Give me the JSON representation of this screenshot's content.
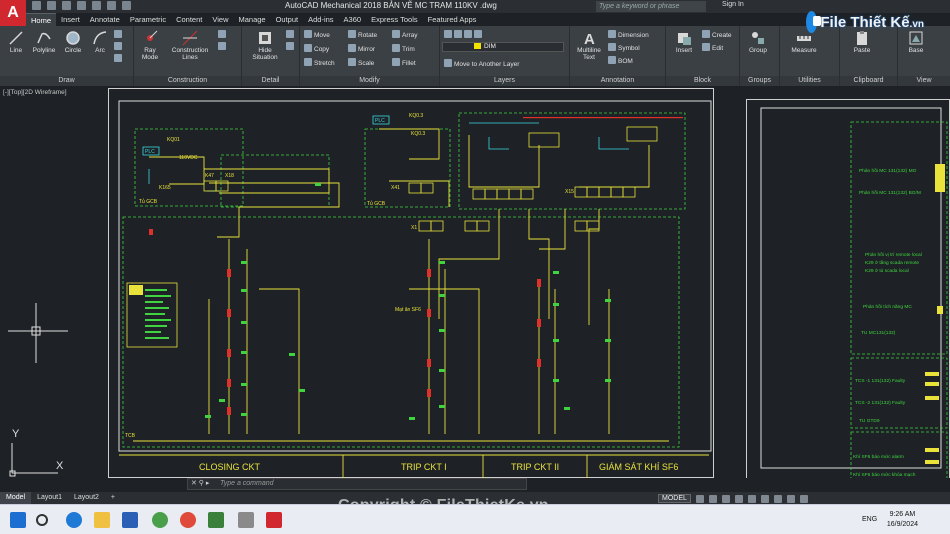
{
  "window": {
    "title": "AutoCAD Mechanical 2018   BẢN VẼ MC TRAM 110KV  .dwg",
    "search_placeholder": "Type a keyword or phrase",
    "sign_in": "Sign In"
  },
  "brand": {
    "name": "File Thiết Kế",
    "tld": ".vn"
  },
  "ribbon_tabs": [
    "Home",
    "Insert",
    "Annotate",
    "Parametric",
    "Content",
    "View",
    "Manage",
    "Output",
    "Add-ins",
    "A360",
    "Express Tools",
    "Featured Apps"
  ],
  "draw_panel": {
    "title": "Draw",
    "line": "Line",
    "polyline": "Polyline",
    "circle": "Circle",
    "arc": "Arc"
  },
  "construction_panel": {
    "title": "Construction",
    "ray": "Ray",
    "mode": "Mode",
    "construction": "Construction",
    "lines": "Lines"
  },
  "detail_panel": {
    "title": "Detail",
    "hide": "Hide",
    "situation": "Situation"
  },
  "modify_panel": {
    "title": "Modify",
    "move": "Move",
    "rotate": "Rotate",
    "array": "Array",
    "copy": "Copy",
    "mirror": "Mirror",
    "trim": "Trim",
    "stretch": "Stretch",
    "scale": "Scale",
    "fillet": "Fillet"
  },
  "layers_panel": {
    "title": "Layers",
    "current_layer": "DIM",
    "move_to_layer": "Move to Another Layer"
  },
  "annotation_panel": {
    "title": "Annotation",
    "multiline": "Multiline",
    "text": "Text",
    "dimension": "Dimension",
    "symbol": "Symbol",
    "bom": "BOM"
  },
  "block_panel": {
    "title": "Block",
    "insert": "Insert",
    "create": "Create",
    "edit": "Edit"
  },
  "groups_panel": {
    "title": "Groups",
    "group": "Group"
  },
  "utilities_panel": {
    "title": "Utilities",
    "measure": "Measure"
  },
  "clipboard_panel": {
    "title": "Clipboard",
    "paste": "Paste"
  },
  "view_panel": {
    "title": "View",
    "base": "Base"
  },
  "viewport": {
    "label": "[-][Top][2D Wireframe]"
  },
  "drawing": {
    "sections": [
      "CLOSING CKT",
      "TRIP CKT I",
      "TRIP CKT II",
      "GIÁM SÁT KHÍ SF6"
    ],
    "labels": {
      "plc1": "PLC",
      "plc2": "PLC",
      "kq01": "KQ01",
      "kq03": "KQ0.3",
      "kq03b": "KQ0.3",
      "k47": "K47",
      "k165": "K165",
      "x18": "X18",
      "x41": "X41",
      "x1": "X1",
      "x15": "X15",
      "tugcb": "Tủ GCB",
      "tugcb2": "Tủ GCB",
      "tcb": "TCB",
      "vdc": "110VDC",
      "gs": "Mạt ăn SF6"
    },
    "right_notes": [
      "Phản hồi MC 131(132) MO",
      "Phản hồi MC 131(132) BG/M",
      "Phản hồi vị trí remote local",
      "K29 ở tầng scada remote",
      "K29 ở tủ scada local",
      "Phản hồi tích năng MC",
      "TU MC131(132)",
      "TCS -1 131(132) Faulty",
      "TCS -2 131(132) Faulty",
      "TU GTD9",
      "Khí SF6 báo mức alarm",
      "Khí SF6 báo mức khóa mạch"
    ]
  },
  "command_line": {
    "prompt": "Type a command"
  },
  "layout_tabs": [
    "Model",
    "Layout1",
    "Layout2"
  ],
  "status": {
    "model": "MODEL"
  },
  "watermark": "Copyright © FileThietKe.vn",
  "taskbar": {
    "time": "9:26 AM",
    "date": "16/9/2024",
    "lang": "ENG"
  },
  "colors": {
    "accent": "#d0282e",
    "wire_yellow": "#e8e23a",
    "wire_green": "#3fd43f",
    "wire_cyan": "#36d8e0"
  }
}
